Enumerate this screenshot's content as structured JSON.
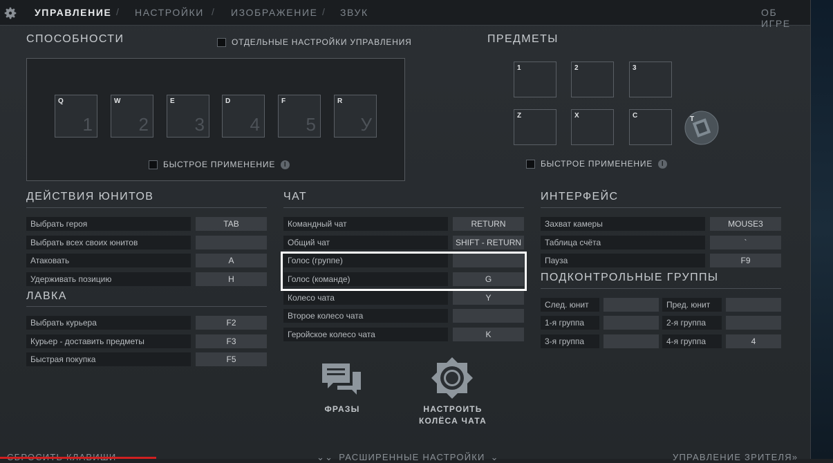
{
  "nav": {
    "tabs": [
      {
        "label": "УПРАВЛЕНИЕ"
      },
      {
        "label": "НАСТРОЙКИ"
      },
      {
        "label": "ИЗОБРАЖЕНИЕ"
      },
      {
        "label": "ЗВУК"
      }
    ],
    "separator": "/",
    "about": "ОБ ИГРЕ"
  },
  "abilities": {
    "title": "СПОСОБНОСТИ",
    "separate_settings": "ОТДЕЛЬНЫЕ НАСТРОЙКИ УПРАВЛЕНИЯ",
    "slots": [
      {
        "key": "Q",
        "num": "1"
      },
      {
        "key": "W",
        "num": "2"
      },
      {
        "key": "E",
        "num": "3"
      },
      {
        "key": "D",
        "num": "4"
      },
      {
        "key": "F",
        "num": "5"
      },
      {
        "key": "R",
        "num": "У"
      }
    ],
    "quick_cast": "БЫСТРОЕ ПРИМЕНЕНИЕ"
  },
  "items": {
    "title": "ПРЕДМЕТЫ",
    "slots": [
      "1",
      "2",
      "3",
      "Z",
      "X",
      "C"
    ],
    "tp_key": "T",
    "quick_cast": "БЫСТРОЕ ПРИМЕНЕНИЕ"
  },
  "unit_actions": {
    "title": "ДЕЙСТВИЯ ЮНИТОВ",
    "rows": [
      {
        "label": "Выбрать героя",
        "key": "TAB"
      },
      {
        "label": "Выбрать всех своих юнитов",
        "key": ""
      },
      {
        "label": "Атаковать",
        "key": "A"
      },
      {
        "label": "Удерживать позицию",
        "key": "H"
      }
    ]
  },
  "shop": {
    "title": "ЛАВКА",
    "rows": [
      {
        "label": "Выбрать курьера",
        "key": "F2"
      },
      {
        "label": "Курьер - доставить предметы",
        "key": "F3"
      },
      {
        "label": "Быстрая покупка",
        "key": "F5"
      }
    ]
  },
  "chat": {
    "title": "ЧАТ",
    "rows": [
      {
        "label": "Командный чат",
        "key": "RETURN"
      },
      {
        "label": "Общий чат",
        "key": "SHIFT - RETURN"
      },
      {
        "label": "Голос (группе)",
        "key": ""
      },
      {
        "label": "Голос (команде)",
        "key": "G"
      },
      {
        "label": "Колесо чата",
        "key": "Y"
      },
      {
        "label": "Второе колесо чата",
        "key": ""
      },
      {
        "label": "Геройское колесо чата",
        "key": "K"
      }
    ],
    "phrases_label": "ФРАЗЫ",
    "wheel_label_1": "НАСТРОИТЬ",
    "wheel_label_2": "КОЛЁСА ЧАТА"
  },
  "interface": {
    "title": "ИНТЕРФЕЙС",
    "rows": [
      {
        "label": "Захват камеры",
        "key": "MOUSE3"
      },
      {
        "label": "Таблица счёта",
        "key": "`"
      },
      {
        "label": "Пауза",
        "key": "F9"
      }
    ]
  },
  "control_groups": {
    "title": "ПОДКОНТРОЛЬНЫЕ ГРУППЫ",
    "rows": [
      {
        "l1": "След. юнит",
        "k1": "",
        "l2": "Пред. юнит",
        "k2": ""
      },
      {
        "l1": "1-я группа",
        "k1": "",
        "l2": "2-я группа",
        "k2": ""
      },
      {
        "l1": "3-я группа",
        "k1": "",
        "l2": "4-я группа",
        "k2": "4"
      }
    ]
  },
  "bottom": {
    "reset": "СБРОСИТЬ КЛАВИШИ",
    "advanced": "РАСШИРЕННЫЕ НАСТРОЙКИ",
    "spectator": "УПРАВЛЕНИЕ ЗРИТЕЛЯ"
  }
}
